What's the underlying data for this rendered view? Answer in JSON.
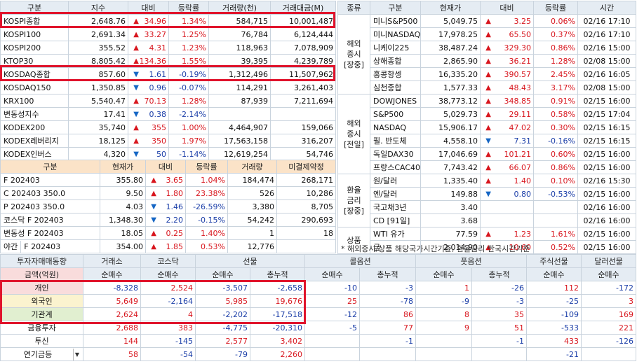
{
  "domestic": {
    "headers": [
      "구분",
      "지수",
      "대비",
      "등락률",
      "거래량(천)",
      "거래대금(M)"
    ],
    "rows": [
      {
        "name": "KOSPI종합",
        "value": "2,648.76",
        "dir": "up",
        "change": "34.96",
        "rate": "1.34%",
        "volume": "584,715",
        "amount": "10,001,487"
      },
      {
        "name": "KOSPI100",
        "value": "2,691.34",
        "dir": "up",
        "change": "33.27",
        "rate": "1.25%",
        "volume": "76,784",
        "amount": "6,124,444"
      },
      {
        "name": "KOSPI200",
        "value": "355.52",
        "dir": "up",
        "change": "4.31",
        "rate": "1.23%",
        "volume": "118,963",
        "amount": "7,078,909"
      },
      {
        "name": "KTOP30",
        "value": "8,805.42",
        "dir": "up",
        "change": "134.36",
        "rate": "1.55%",
        "volume": "39,395",
        "amount": "4,239,789"
      },
      {
        "name": "KOSDAQ종합",
        "value": "857.60",
        "dir": "dn",
        "change": "1.61",
        "rate": "-0.19%",
        "volume": "1,312,496",
        "amount": "11,507,962"
      },
      {
        "name": "KOSDAQ150",
        "value": "1,350.85",
        "dir": "dn",
        "change": "0.96",
        "rate": "-0.07%",
        "volume": "114,291",
        "amount": "3,261,403"
      },
      {
        "name": "KRX100",
        "value": "5,540.47",
        "dir": "up",
        "change": "70.13",
        "rate": "1.28%",
        "volume": "87,939",
        "amount": "7,211,694"
      },
      {
        "name": "변동성지수",
        "value": "17.41",
        "dir": "dn",
        "change": "0.38",
        "rate": "-2.14%",
        "volume": "",
        "amount": ""
      },
      {
        "name": "KODEX200",
        "value": "35,740",
        "dir": "up",
        "change": "355",
        "rate": "1.00%",
        "volume": "4,464,907",
        "amount": "159,066"
      },
      {
        "name": "KODEX레버리지",
        "value": "18,125",
        "dir": "up",
        "change": "350",
        "rate": "1.97%",
        "volume": "17,563,158",
        "amount": "316,207"
      },
      {
        "name": "KODEX인버스",
        "value": "4,320",
        "dir": "dn",
        "change": "50",
        "rate": "-1.14%",
        "volume": "12,619,254",
        "amount": "54,746"
      }
    ]
  },
  "futures": {
    "headers": [
      "구분",
      "현재가",
      "대비",
      "등락률",
      "거래량",
      "미결제약정"
    ],
    "rows": [
      {
        "name": "F 202403",
        "value": "355.80",
        "dir": "up",
        "change": "3.65",
        "rate": "1.04%",
        "volume": "184,474",
        "oi": "268,171"
      },
      {
        "name": "C 202403 350.0",
        "value": "9.50",
        "dir": "up",
        "change": "1.80",
        "rate": "23.38%",
        "volume": "526",
        "oi": "10,286"
      },
      {
        "name": "P 202403 350.0",
        "value": "4.03",
        "dir": "dn",
        "change": "1.46",
        "rate": "-26.59%",
        "volume": "3,380",
        "oi": "8,705"
      },
      {
        "name": "코스닥 F 202403",
        "value": "1,348.30",
        "dir": "dn",
        "change": "2.20",
        "rate": "-0.15%",
        "volume": "54,242",
        "oi": "290,693"
      },
      {
        "name": "변동성 F 202403",
        "value": "18.05",
        "dir": "up",
        "change": "0.25",
        "rate": "1.40%",
        "volume": "1",
        "oi": "18"
      },
      {
        "name_a": "야간",
        "name_b": "F 202403",
        "value": "354.00",
        "dir": "up",
        "change": "1.85",
        "rate": "0.53%",
        "volume": "12,776",
        "oi": ""
      }
    ]
  },
  "overseas": {
    "headers": [
      "종류",
      "구분",
      "현재가",
      "대비",
      "등락률",
      "시간"
    ],
    "groups": [
      {
        "label": "해외\n증시\n[장중]",
        "rows": [
          {
            "name": "미니S&P500",
            "value": "5,049.75",
            "dir": "up",
            "change": "3.25",
            "rate": "0.06%",
            "time": "02/16 17:10"
          },
          {
            "name": "미니NASDAQ",
            "value": "17,978.25",
            "dir": "up",
            "change": "65.50",
            "rate": "0.37%",
            "time": "02/16 17:10"
          },
          {
            "name": "니케이225",
            "value": "38,487.24",
            "dir": "up",
            "change": "329.30",
            "rate": "0.86%",
            "time": "02/16 15:00"
          },
          {
            "name": "상해종합",
            "value": "2,865.90",
            "dir": "up",
            "change": "36.21",
            "rate": "1.28%",
            "time": "02/08 15:00"
          },
          {
            "name": "홍콩항셍",
            "value": "16,335.20",
            "dir": "up",
            "change": "390.57",
            "rate": "2.45%",
            "time": "02/16 16:05"
          },
          {
            "name": "심천종합",
            "value": "1,577.33",
            "dir": "up",
            "change": "48.43",
            "rate": "3.17%",
            "time": "02/08 15:00"
          }
        ]
      },
      {
        "label": "해외\n증시\n[전일]",
        "rows": [
          {
            "name": "DOWJONES",
            "value": "38,773.12",
            "dir": "up",
            "change": "348.85",
            "rate": "0.91%",
            "time": "02/15 16:00"
          },
          {
            "name": "S&P500",
            "value": "5,029.73",
            "dir": "up",
            "change": "29.11",
            "rate": "0.58%",
            "time": "02/15 17:04"
          },
          {
            "name": "NASDAQ",
            "value": "15,906.17",
            "dir": "up",
            "change": "47.02",
            "rate": "0.30%",
            "time": "02/15 16:15"
          },
          {
            "name": "필. 반도체",
            "value": "4,558.10",
            "dir": "dn",
            "change": "7.31",
            "rate": "-0.16%",
            "time": "02/15 16:15"
          },
          {
            "name": "독일DAX30",
            "value": "17,046.69",
            "dir": "up",
            "change": "101.21",
            "rate": "0.60%",
            "time": "02/15 16:00"
          },
          {
            "name": "프랑스CAC40",
            "value": "7,743.42",
            "dir": "up",
            "change": "66.07",
            "rate": "0.86%",
            "time": "02/15 16:00"
          }
        ]
      },
      {
        "label": "환율\n금리\n[장중]",
        "rows": [
          {
            "name": "원/달러",
            "value": "1,335.40",
            "dir": "up",
            "change": "1.40",
            "rate": "0.10%",
            "time": "02/16 15:30"
          },
          {
            "name": "엔/달러",
            "value": "149.88",
            "dir": "dn",
            "change": "0.80",
            "rate": "-0.53%",
            "time": "02/15 16:00"
          },
          {
            "name": "국고채3년",
            "value": "3.40",
            "dir": "",
            "change": "",
            "rate": "",
            "time": "02/16 16:00"
          },
          {
            "name": "CD [91일]",
            "value": "3.68",
            "dir": "",
            "change": "",
            "rate": "",
            "time": "02/16 16:00"
          }
        ]
      },
      {
        "label": "상품",
        "rows": [
          {
            "name": "WTI 유가",
            "value": "77.59",
            "dir": "up",
            "change": "1.23",
            "rate": "1.61%",
            "time": "02/15 16:00"
          },
          {
            "name": "금",
            "value": "2,014.90",
            "dir": "up",
            "change": "10.60",
            "rate": "0.52%",
            "time": "02/15 16:00"
          }
        ]
      }
    ],
    "note": "* 해외증시/상품 해당국가시간기준, 환율금리 한국시간기준"
  },
  "investors": {
    "title": "투자자매매동향",
    "unit": "금액(억원)",
    "top_headers": [
      "거래소",
      "코스닥",
      "선물",
      "콜옵션",
      "풋옵션",
      "주식선물",
      "달러선물"
    ],
    "sub_headers": [
      "순매수",
      "순매수",
      "순매수",
      "총누적",
      "순매수",
      "총누적",
      "순매수",
      "총누적",
      "순매수",
      "순매수"
    ],
    "rows": [
      {
        "name": "개인",
        "vals": [
          "-8,328",
          "2,524",
          "-3,507",
          "-2,658",
          "-10",
          "-3",
          "1",
          "-26",
          "112",
          "-172"
        ]
      },
      {
        "name": "외국인",
        "vals": [
          "5,649",
          "-2,164",
          "5,985",
          "19,676",
          "25",
          "-78",
          "-9",
          "-3",
          "-25",
          "3"
        ]
      },
      {
        "name": "기관계",
        "vals": [
          "2,624",
          "4",
          "-2,202",
          "-17,518",
          "-12",
          "86",
          "8",
          "35",
          "-109",
          "169"
        ]
      },
      {
        "name": "금융투자",
        "vals": [
          "2,688",
          "383",
          "-4,775",
          "-20,310",
          "-5",
          "77",
          "9",
          "51",
          "-533",
          "221"
        ]
      },
      {
        "name": "투신",
        "vals": [
          "144",
          "-145",
          "2,577",
          "3,402",
          "",
          "-1",
          "",
          "-1",
          "433",
          "-126"
        ]
      },
      {
        "name": "연기금등",
        "vals": [
          "58",
          "-54",
          "-79",
          "2,260",
          "",
          "",
          "",
          "",
          "-21",
          ""
        ]
      }
    ]
  }
}
